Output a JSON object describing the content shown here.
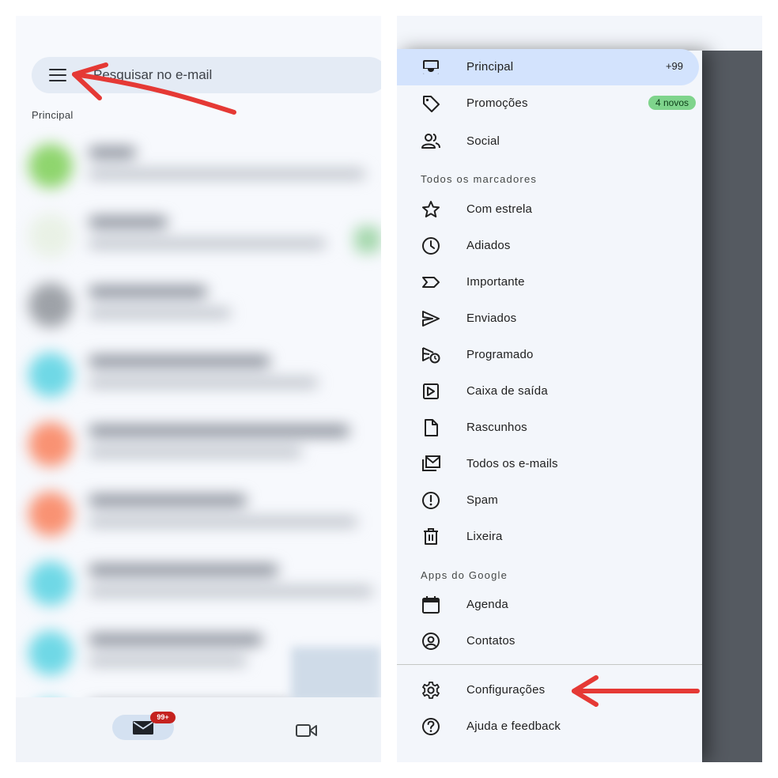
{
  "left_screen": {
    "search": {
      "placeholder": "Pesquisar no e-mail",
      "visible_text": "esquisar no e-mail"
    },
    "section_label": "Principal",
    "bottom_nav": {
      "mail_badge": "99+",
      "mail_icon": "mail-icon",
      "meet_icon": "video-camera-icon"
    }
  },
  "drawer": {
    "inboxes": [
      {
        "label": "Principal",
        "icon": "inbox-icon",
        "count": "+99",
        "active": true
      },
      {
        "label": "Promoções",
        "icon": "tag-icon",
        "pill": "4 novos"
      },
      {
        "label": "Social",
        "icon": "people-icon"
      }
    ],
    "labels_header": "Todos os marcadores",
    "labels": [
      {
        "label": "Com estrela",
        "icon": "star-icon"
      },
      {
        "label": "Adiados",
        "icon": "clock-icon"
      },
      {
        "label": "Importante",
        "icon": "important-icon"
      },
      {
        "label": "Enviados",
        "icon": "send-icon"
      },
      {
        "label": "Programado",
        "icon": "scheduled-send-icon"
      },
      {
        "label": "Caixa de saída",
        "icon": "outbox-icon"
      },
      {
        "label": "Rascunhos",
        "icon": "draft-icon"
      },
      {
        "label": "Todos os e-mails",
        "icon": "all-mail-icon"
      },
      {
        "label": "Spam",
        "icon": "spam-icon"
      },
      {
        "label": "Lixeira",
        "icon": "trash-icon"
      }
    ],
    "google_apps_header": "Apps do Google",
    "google_apps": [
      {
        "label": "Agenda",
        "icon": "calendar-icon"
      },
      {
        "label": "Contatos",
        "icon": "contacts-icon"
      }
    ],
    "footer": [
      {
        "label": "Configurações",
        "icon": "gear-icon"
      },
      {
        "label": "Ajuda e feedback",
        "icon": "help-icon"
      }
    ]
  },
  "colors": {
    "annotation_arrow": "#e53935",
    "active_item_bg": "#d3e3fd",
    "new_pill_bg": "#7fd48c",
    "badge_bg": "#c5221f"
  }
}
